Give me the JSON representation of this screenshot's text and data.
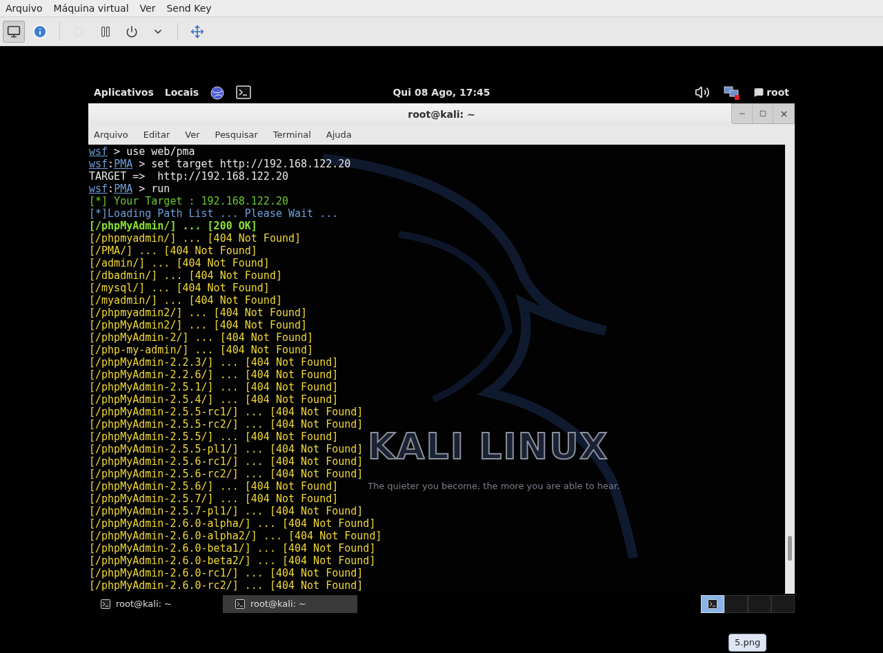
{
  "host_menu": [
    "Arquivo",
    "Máquina virtual",
    "Ver",
    "Send Key"
  ],
  "host_toolbar": [
    {
      "kind": "display",
      "pressed": true,
      "disabled": false
    },
    {
      "kind": "info",
      "pressed": false,
      "disabled": false
    },
    {
      "kind": "sep"
    },
    {
      "kind": "run",
      "pressed": false,
      "disabled": true
    },
    {
      "kind": "pause",
      "pressed": false,
      "disabled": false
    },
    {
      "kind": "power",
      "pressed": false,
      "disabled": false
    },
    {
      "kind": "dropdown",
      "pressed": false,
      "disabled": false
    },
    {
      "kind": "sep"
    },
    {
      "kind": "fullscreen",
      "pressed": false,
      "disabled": false
    }
  ],
  "top_bar": {
    "menus": [
      "Aplicativos",
      "Locais"
    ],
    "clock": "Qui 08 Ago, 17:45",
    "user": "root"
  },
  "wallpaper": {
    "logo": "KALI LINUX",
    "tagline": "The quieter you become, the more you are able to hear."
  },
  "terminal": {
    "title": "root@kali: ~",
    "menu": [
      "Arquivo",
      "Editar",
      "Ver",
      "Pesquisar",
      "Terminal",
      "Ajuda"
    ],
    "lines": [
      {
        "kind": "command",
        "segments": [
          {
            "kind": "link",
            "text": "wsf"
          },
          {
            "kind": "plain",
            "text": " > use web/pma"
          }
        ]
      },
      {
        "kind": "command",
        "segments": [
          {
            "kind": "link",
            "text": "wsf"
          },
          {
            "kind": "plain",
            "text": ":"
          },
          {
            "kind": "link",
            "text": "PMA"
          },
          {
            "kind": "plain",
            "text": " > set target http://192.168.122.20"
          }
        ]
      },
      {
        "kind": "plain",
        "text": "TARGET =>  http://192.168.122.20"
      },
      {
        "kind": "command",
        "segments": [
          {
            "kind": "link",
            "text": "wsf"
          },
          {
            "kind": "plain",
            "text": ":"
          },
          {
            "kind": "link",
            "text": "PMA"
          },
          {
            "kind": "plain",
            "text": " > run"
          }
        ]
      },
      {
        "kind": "info",
        "text": "[*] Your Target : 192.168.122.20"
      },
      {
        "kind": "loading",
        "text": "[*]Loading Path List ... Please Wait ..."
      },
      {
        "kind": "found",
        "text": "[/phpMyAdmin/] ... [200 OK]"
      },
      {
        "kind": "notfound",
        "text": "[/phpmyadmin/] ... [404 Not Found]"
      },
      {
        "kind": "notfound",
        "text": "[/PMA/] ... [404 Not Found]"
      },
      {
        "kind": "notfound",
        "text": "[/admin/] ... [404 Not Found]"
      },
      {
        "kind": "notfound",
        "text": "[/dbadmin/] ... [404 Not Found]"
      },
      {
        "kind": "notfound",
        "text": "[/mysql/] ... [404 Not Found]"
      },
      {
        "kind": "notfound",
        "text": "[/myadmin/] ... [404 Not Found]"
      },
      {
        "kind": "notfound",
        "text": "[/phpmyadmin2/] ... [404 Not Found]"
      },
      {
        "kind": "notfound",
        "text": "[/phpMyAdmin2/] ... [404 Not Found]"
      },
      {
        "kind": "notfound",
        "text": "[/phpMyAdmin-2/] ... [404 Not Found]"
      },
      {
        "kind": "notfound",
        "text": "[/php-my-admin/] ... [404 Not Found]"
      },
      {
        "kind": "notfound",
        "text": "[/phpMyAdmin-2.2.3/] ... [404 Not Found]"
      },
      {
        "kind": "notfound",
        "text": "[/phpMyAdmin-2.2.6/] ... [404 Not Found]"
      },
      {
        "kind": "notfound",
        "text": "[/phpMyAdmin-2.5.1/] ... [404 Not Found]"
      },
      {
        "kind": "notfound",
        "text": "[/phpMyAdmin-2.5.4/] ... [404 Not Found]"
      },
      {
        "kind": "notfound",
        "text": "[/phpMyAdmin-2.5.5-rc1/] ... [404 Not Found]"
      },
      {
        "kind": "notfound",
        "text": "[/phpMyAdmin-2.5.5-rc2/] ... [404 Not Found]"
      },
      {
        "kind": "notfound",
        "text": "[/phpMyAdmin-2.5.5/] ... [404 Not Found]"
      },
      {
        "kind": "notfound",
        "text": "[/phpMyAdmin-2.5.5-pl1/] ... [404 Not Found]"
      },
      {
        "kind": "notfound",
        "text": "[/phpMyAdmin-2.5.6-rc1/] ... [404 Not Found]"
      },
      {
        "kind": "notfound",
        "text": "[/phpMyAdmin-2.5.6-rc2/] ... [404 Not Found]"
      },
      {
        "kind": "notfound",
        "text": "[/phpMyAdmin-2.5.6/] ... [404 Not Found]"
      },
      {
        "kind": "notfound",
        "text": "[/phpMyAdmin-2.5.7/] ... [404 Not Found]"
      },
      {
        "kind": "notfound",
        "text": "[/phpMyAdmin-2.5.7-pl1/] ... [404 Not Found]"
      },
      {
        "kind": "notfound",
        "text": "[/phpMyAdmin-2.6.0-alpha/] ... [404 Not Found]"
      },
      {
        "kind": "notfound",
        "text": "[/phpMyAdmin-2.6.0-alpha2/] ... [404 Not Found]"
      },
      {
        "kind": "notfound",
        "text": "[/phpMyAdmin-2.6.0-beta1/] ... [404 Not Found]"
      },
      {
        "kind": "notfound",
        "text": "[/phpMyAdmin-2.6.0-beta2/] ... [404 Not Found]"
      },
      {
        "kind": "notfound",
        "text": "[/phpMyAdmin-2.6.0-rc1/] ... [404 Not Found]"
      },
      {
        "kind": "notfound",
        "text": "[/phpMyAdmin-2.6.0-rc2/] ... [404 Not Found]"
      }
    ]
  },
  "taskbar": {
    "windows": [
      {
        "label": "root@kali: ~",
        "selected": false
      },
      {
        "label": "root@kali: ~",
        "selected": true
      }
    ],
    "workspaces": [
      {
        "selected": true,
        "has_window": true
      },
      {
        "selected": false,
        "has_window": false
      },
      {
        "selected": false,
        "has_window": false
      },
      {
        "selected": false,
        "has_window": false
      }
    ]
  },
  "tooltip": "5.png"
}
